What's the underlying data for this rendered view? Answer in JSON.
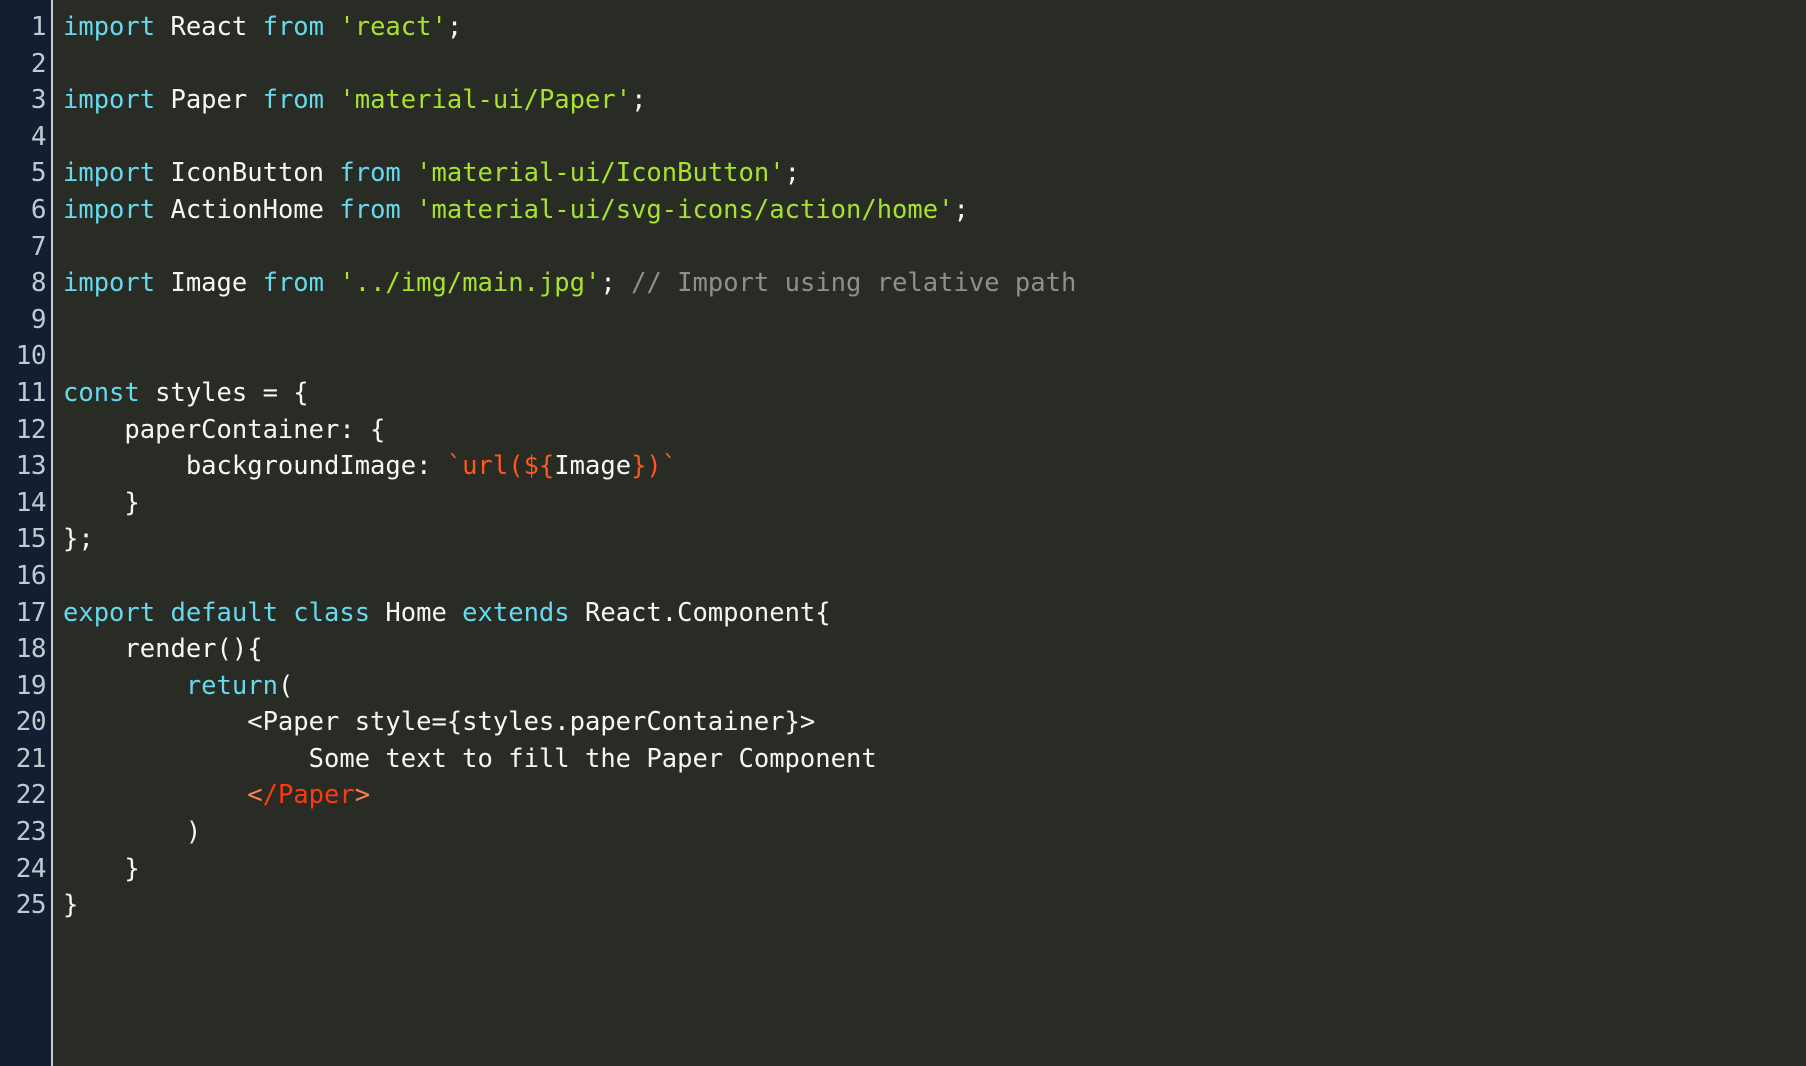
{
  "editor": {
    "theme_name": "monokai-dark",
    "colors": {
      "background": "#282c24",
      "gutter_background": "#141e32",
      "gutter_text": "#c3c9d1",
      "gutter_divider": "#c8cdd4",
      "plain_text": "#f7f7f2",
      "keyword": "#66d9ef",
      "string": "#a6e22e",
      "comment": "#8f908a",
      "template_literal": "#fd5620",
      "jsx_bracket": "#fd8050",
      "jsx_tagname": "#fd3a10"
    },
    "language": "javascript-jsx",
    "total_lines": 25,
    "line_numbers": [
      "1",
      "2",
      "3",
      "4",
      "5",
      "6",
      "7",
      "8",
      "9",
      "10",
      "11",
      "12",
      "13",
      "14",
      "15",
      "16",
      "17",
      "18",
      "19",
      "20",
      "21",
      "22",
      "23",
      "24",
      "25"
    ],
    "lines": [
      {
        "number": "1",
        "text": "import React from 'react';",
        "tokens": [
          {
            "text": "import",
            "type": "keyword"
          },
          {
            "text": " React ",
            "type": "plain"
          },
          {
            "text": "from",
            "type": "keyword"
          },
          {
            "text": " ",
            "type": "plain"
          },
          {
            "text": "'react'",
            "type": "string"
          },
          {
            "text": ";",
            "type": "plain"
          }
        ]
      },
      {
        "number": "2",
        "text": "",
        "tokens": []
      },
      {
        "number": "3",
        "text": "import Paper from 'material-ui/Paper';",
        "tokens": [
          {
            "text": "import",
            "type": "keyword"
          },
          {
            "text": " Paper ",
            "type": "plain"
          },
          {
            "text": "from",
            "type": "keyword"
          },
          {
            "text": " ",
            "type": "plain"
          },
          {
            "text": "'material-ui/Paper'",
            "type": "string"
          },
          {
            "text": ";",
            "type": "plain"
          }
        ]
      },
      {
        "number": "4",
        "text": "",
        "tokens": []
      },
      {
        "number": "5",
        "text": "import IconButton from 'material-ui/IconButton';",
        "tokens": [
          {
            "text": "import",
            "type": "keyword"
          },
          {
            "text": " IconButton ",
            "type": "plain"
          },
          {
            "text": "from",
            "type": "keyword"
          },
          {
            "text": " ",
            "type": "plain"
          },
          {
            "text": "'material-ui/IconButton'",
            "type": "string"
          },
          {
            "text": ";",
            "type": "plain"
          }
        ]
      },
      {
        "number": "6",
        "text": "import ActionHome from 'material-ui/svg-icons/action/home';",
        "tokens": [
          {
            "text": "import",
            "type": "keyword"
          },
          {
            "text": " ActionHome ",
            "type": "plain"
          },
          {
            "text": "from",
            "type": "keyword"
          },
          {
            "text": " ",
            "type": "plain"
          },
          {
            "text": "'material-ui/svg-icons/action/home'",
            "type": "string"
          },
          {
            "text": ";",
            "type": "plain"
          }
        ]
      },
      {
        "number": "7",
        "text": "",
        "tokens": []
      },
      {
        "number": "8",
        "text": "import Image from '../img/main.jpg'; // Import using relative path",
        "tokens": [
          {
            "text": "import",
            "type": "keyword"
          },
          {
            "text": " Image ",
            "type": "plain"
          },
          {
            "text": "from",
            "type": "keyword"
          },
          {
            "text": " ",
            "type": "plain"
          },
          {
            "text": "'../img/main.jpg'",
            "type": "string"
          },
          {
            "text": "; ",
            "type": "plain"
          },
          {
            "text": "// Import using relative path",
            "type": "comment"
          }
        ]
      },
      {
        "number": "9",
        "text": "",
        "tokens": []
      },
      {
        "number": "10",
        "text": "",
        "tokens": []
      },
      {
        "number": "11",
        "text": "const styles = {",
        "tokens": [
          {
            "text": "const",
            "type": "keyword"
          },
          {
            "text": " styles = {",
            "type": "plain"
          }
        ]
      },
      {
        "number": "12",
        "text": "    paperContainer: {",
        "tokens": [
          {
            "text": "    paperContainer: {",
            "type": "plain"
          }
        ]
      },
      {
        "number": "13",
        "text": "        backgroundImage: `url(${Image})`",
        "tokens": [
          {
            "text": "        backgroundImage: ",
            "type": "plain"
          },
          {
            "text": "`url($",
            "type": "template_literal"
          },
          {
            "text": "{",
            "type": "template_literal"
          },
          {
            "text": "Image",
            "type": "plain"
          },
          {
            "text": "})`",
            "type": "template_literal"
          }
        ]
      },
      {
        "number": "14",
        "text": "    }",
        "tokens": [
          {
            "text": "    }",
            "type": "plain"
          }
        ]
      },
      {
        "number": "15",
        "text": "};",
        "tokens": [
          {
            "text": "};",
            "type": "plain"
          }
        ]
      },
      {
        "number": "16",
        "text": "",
        "tokens": []
      },
      {
        "number": "17",
        "text": "export default class Home extends React.Component{",
        "tokens": [
          {
            "text": "export default class",
            "type": "keyword"
          },
          {
            "text": " Home ",
            "type": "plain"
          },
          {
            "text": "extends",
            "type": "keyword"
          },
          {
            "text": " React.Component{",
            "type": "plain"
          }
        ]
      },
      {
        "number": "18",
        "text": "    render(){",
        "tokens": [
          {
            "text": "    render(){",
            "type": "plain"
          }
        ]
      },
      {
        "number": "19",
        "text": "        return(",
        "tokens": [
          {
            "text": "        ",
            "type": "plain"
          },
          {
            "text": "return",
            "type": "keyword"
          },
          {
            "text": "(",
            "type": "plain"
          }
        ]
      },
      {
        "number": "20",
        "text": "            <Paper style={styles.paperContainer}>",
        "tokens": [
          {
            "text": "            <Paper style={styles.paperContainer}>",
            "type": "plain"
          }
        ]
      },
      {
        "number": "21",
        "text": "                Some text to fill the Paper Component",
        "tokens": [
          {
            "text": "                Some text to fill the Paper Component",
            "type": "plain"
          }
        ]
      },
      {
        "number": "22",
        "text": "            </Paper>",
        "tokens": [
          {
            "text": "            ",
            "type": "plain"
          },
          {
            "text": "<",
            "type": "jsx_bracket"
          },
          {
            "text": "/Paper",
            "type": "jsx_tagname"
          },
          {
            "text": ">",
            "type": "jsx_bracket"
          }
        ]
      },
      {
        "number": "23",
        "text": "        )",
        "tokens": [
          {
            "text": "        )",
            "type": "plain"
          }
        ]
      },
      {
        "number": "24",
        "text": "    }",
        "tokens": [
          {
            "text": "    }",
            "type": "plain"
          }
        ]
      },
      {
        "number": "25",
        "text": "}",
        "tokens": [
          {
            "text": "}",
            "type": "plain"
          }
        ]
      }
    ]
  }
}
